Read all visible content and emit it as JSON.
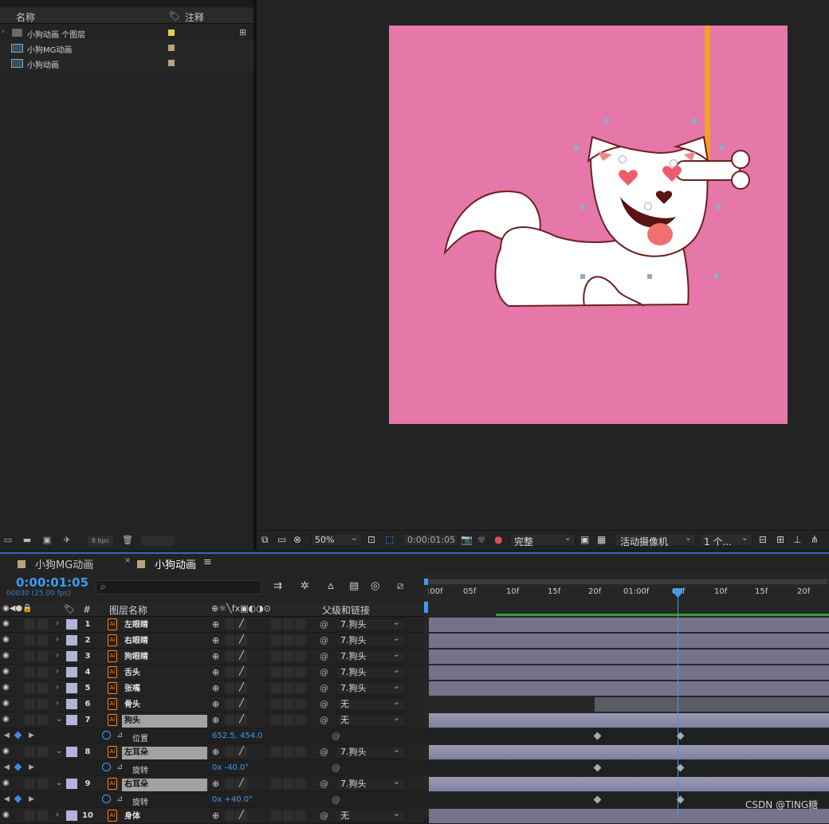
{
  "project": {
    "header": {
      "name_col": "名称",
      "comment_col": "注释"
    },
    "items": [
      {
        "name": "小狗动画 个图层",
        "color": "#e2d24a",
        "type": "folder"
      },
      {
        "name": "小狗MG动画",
        "color": "#b5a47f",
        "type": "comp"
      },
      {
        "name": "小狗动画",
        "color": "#b5a47f",
        "type": "comp"
      }
    ],
    "bpc": "8 bpc"
  },
  "viewer": {
    "canvas_color": "#e578a8",
    "zoom": "50%",
    "timecode": "0:00:01:05",
    "quality": "完整",
    "camera": "活动摄像机",
    "views": "1 个..."
  },
  "timeline": {
    "tabs": [
      "小狗MG动画",
      "小狗动画"
    ],
    "timecode": "0:00:01:05",
    "fps_info": "00030 (25.00 fps)",
    "columns": {
      "num": "#",
      "layer_name": "图层名称",
      "parent": "父级和链接"
    },
    "ruler": [
      ":00f",
      "05f",
      "10f",
      "15f",
      "20f",
      "01:00f",
      "05f",
      "10f",
      "15f",
      "20f"
    ],
    "layers": [
      {
        "num": "1",
        "name": "左眼睛",
        "parent": "7.狗头",
        "selected": false
      },
      {
        "num": "2",
        "name": "右眼睛",
        "parent": "7.狗头",
        "selected": false
      },
      {
        "num": "3",
        "name": "狗眼睛",
        "parent": "7.狗头",
        "selected": false
      },
      {
        "num": "4",
        "name": "舌头",
        "parent": "7.狗头",
        "selected": false
      },
      {
        "num": "5",
        "name": "张嘴",
        "parent": "7.狗头",
        "selected": false
      },
      {
        "num": "6",
        "name": "骨头",
        "parent": "无",
        "selected": false
      },
      {
        "num": "7",
        "name": "狗头",
        "parent": "无",
        "selected": true
      },
      {
        "prop": true,
        "name": "位置",
        "value": "652.5, 454.0"
      },
      {
        "num": "8",
        "name": "左耳朵",
        "parent": "7.狗头",
        "selected": true
      },
      {
        "prop": true,
        "name": "旋转",
        "value": "0x -40.0°"
      },
      {
        "num": "9",
        "name": "右耳朵",
        "parent": "7.狗头",
        "selected": true
      },
      {
        "prop": true,
        "name": "旋转",
        "value": "0x +40.0°"
      },
      {
        "num": "10",
        "name": "身体",
        "parent": "无",
        "selected": false
      }
    ]
  },
  "watermark": "CSDN @TING糖"
}
